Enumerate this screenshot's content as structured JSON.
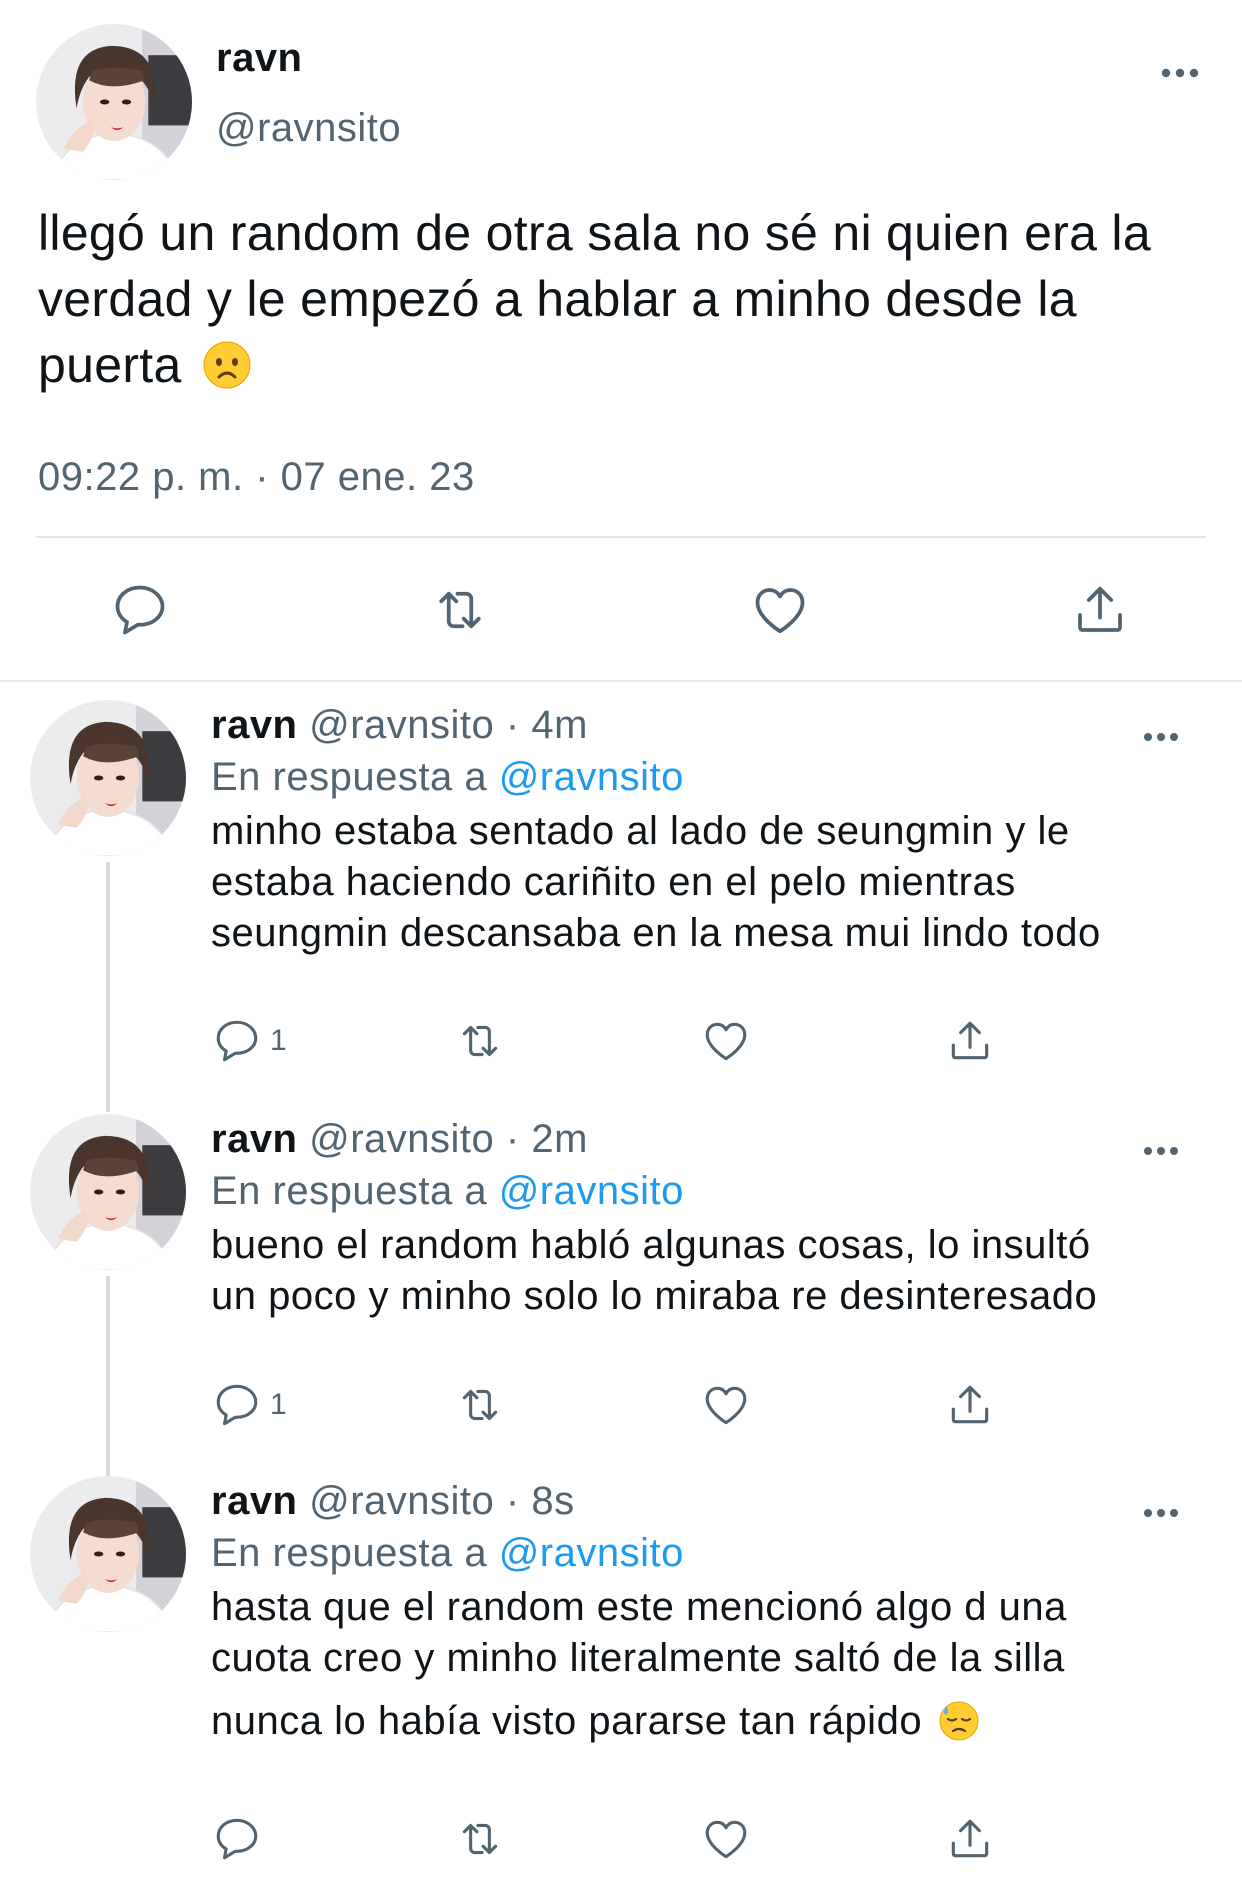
{
  "main_tweet": {
    "name": "ravn",
    "handle": "@ravnsito",
    "text": "llegó un random de otra sala no sé ni quien era la verdad y le empezó a hablar a minho desde la puerta",
    "emoji": "worried-face-emoji",
    "timestamp": "09:22 p. m. · 07 ene. 23",
    "actions": {
      "reply_icon": "speech-bubble-icon",
      "retweet_icon": "retweet-arrows-icon",
      "like_icon": "heart-outline-icon",
      "share_icon": "upload-share-icon"
    }
  },
  "replies": [
    {
      "name": "ravn",
      "handle": "@ravnsito",
      "dot": "·",
      "time": "4m",
      "replying_prefix": "En respuesta a",
      "replying_to": "@ravnsito",
      "lines": [
        "minho estaba sentado al lado de seungmin y le",
        "estaba haciendo cariñito en el pelo mientras",
        "seungmin descansaba en la mesa mui lindo todo"
      ],
      "reply_count": "1"
    },
    {
      "name": "ravn",
      "handle": "@ravnsito",
      "dot": "·",
      "time": "2m",
      "replying_prefix": "En respuesta a",
      "replying_to": "@ravnsito",
      "lines": [
        "bueno el random habló algunas cosas, lo insultó",
        "un poco y minho solo lo miraba re desinteresado"
      ],
      "reply_count": "1"
    },
    {
      "name": "ravn",
      "handle": "@ravnsito",
      "dot": "·",
      "time": "8s",
      "replying_prefix": "En respuesta a",
      "replying_to": "@ravnsito",
      "lines": [
        "hasta que el random este mencionó algo d una",
        "cuota creo y minho literalmente saltó de la silla",
        "nunca lo había visto pararse tan rápido"
      ],
      "emoji": "downcast-sweat-face-emoji",
      "reply_count": ""
    }
  ],
  "colors": {
    "text": "#0f1419",
    "secondary": "#536471",
    "link": "#1d9bf0",
    "divider": "#e1e6ea"
  }
}
